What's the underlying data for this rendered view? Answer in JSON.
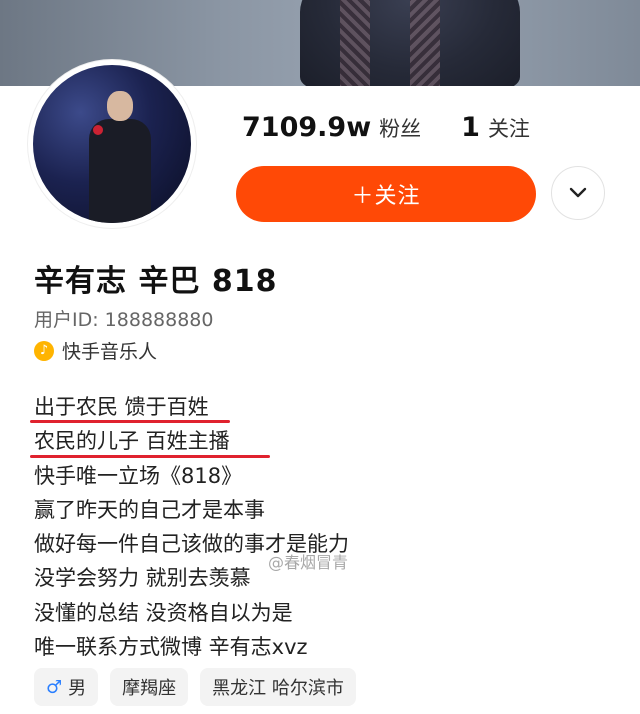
{
  "profile": {
    "followers_count": "7109.9w",
    "followers_label": "粉丝",
    "following_count": "1",
    "following_label": "关注",
    "follow_button": "＋关注",
    "more_icon": "chevron-down-icon",
    "name": "辛有志 辛巴 818",
    "user_id": "用户ID: 188888880",
    "badge_label": "快手音乐人",
    "badge_icon": "music-note-icon"
  },
  "bio": [
    "出于农民 馈于百姓",
    "农民的儿子  百姓主播",
    "快手唯一立场《818》",
    "赢了昨天的自己才是本事",
    "做好每一件自己该做的事才是能力",
    "没学会努力  就别去羡慕",
    "没懂的总结 没资格自以为是",
    "唯一联系方式微博  辛有志xvz"
  ],
  "watermark": "@春烟冒青",
  "chips": {
    "gender": "男",
    "zodiac": "摩羯座",
    "location": "黑龙江 哈尔滨市"
  },
  "colors": {
    "follow_button": "#ff4906",
    "underline": "#e0222e",
    "badge": "#ffb400",
    "gender_icon": "#2a7fff"
  }
}
